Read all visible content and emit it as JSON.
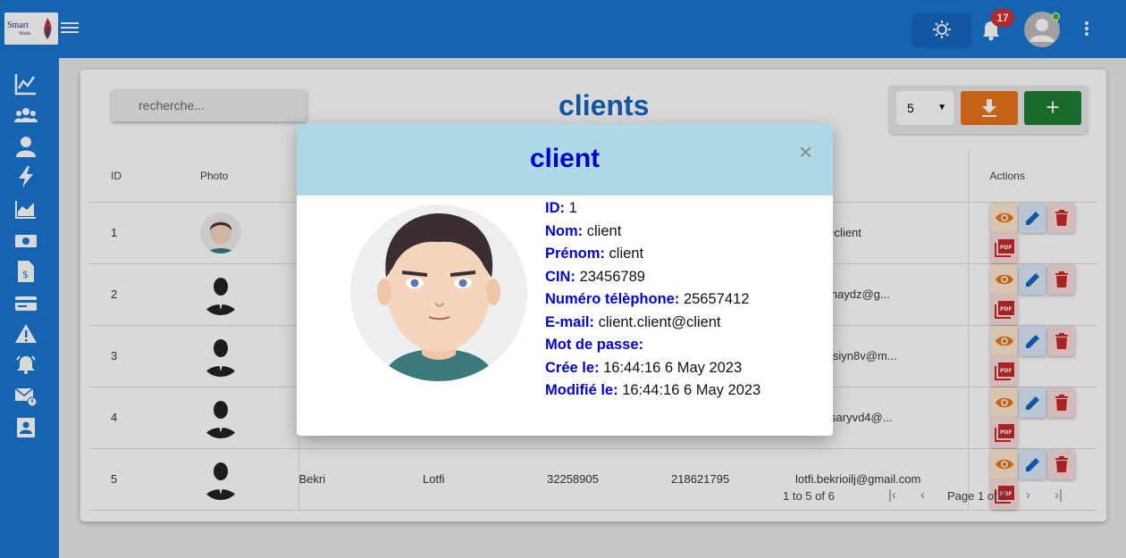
{
  "app": {
    "logo_line1": "Smart",
    "logo_line2": "Watts"
  },
  "header": {
    "notification_count": "17"
  },
  "page": {
    "title": "clients",
    "search_placeholder": "recherche...",
    "page_size": "5",
    "add_label": "+"
  },
  "table": {
    "headers": {
      "id": "ID",
      "photo": "Photo",
      "actions": "Actions"
    },
    "rows": [
      {
        "id": "1",
        "nom": "",
        "prenom": "",
        "cin": "",
        "tel": "",
        "email": "client@client"
      },
      {
        "id": "2",
        "nom": "",
        "prenom": "",
        "cin": "",
        "tel": "",
        "email": "ahfoudhaydz@g..."
      },
      {
        "id": "3",
        "nom": "",
        "prenom": "",
        "cin": "",
        "tel": "",
        "email": "bensassiyn8v@m..."
      },
      {
        "id": "4",
        "nom": "",
        "prenom": "",
        "cin": "",
        "tel": "",
        "email": "oussarsaryvd4@..."
      },
      {
        "id": "5",
        "nom": "Bekri",
        "prenom": "Lotfi",
        "cin": "32258905",
        "tel": "218621795",
        "email": "lotfi.bekrioilj@gmail.com"
      }
    ]
  },
  "pagination": {
    "range": "1 to 5 of 6",
    "page": "Page 1 of 2"
  },
  "modal": {
    "title": "client",
    "close": "×",
    "fields": [
      {
        "label": "ID:",
        "value": "1"
      },
      {
        "label": "Nom:",
        "value": "client"
      },
      {
        "label": "Prénom:",
        "value": "client"
      },
      {
        "label": "CIN:",
        "value": "23456789"
      },
      {
        "label": "Numéro télèphone:",
        "value": "25657412"
      },
      {
        "label": "E-mail:",
        "value": "client.client@client"
      },
      {
        "label": "Mot de passe:",
        "value": ""
      },
      {
        "label": "Crée le:",
        "value": "16:44:16 6 May 2023"
      },
      {
        "label": "Modifié le:",
        "value": "16:44:16 6 May 2023"
      }
    ]
  },
  "colors": {
    "primary": "#1976d2",
    "title_blue": "#0000cc",
    "modal_header": "#add8e6",
    "download": "#e8741a",
    "add": "#1e7e34"
  },
  "icons": [
    "menu-icon",
    "sun-icon",
    "bell-icon",
    "account-icon",
    "more-vert-icon",
    "chart-line-icon",
    "people-icon",
    "person-icon",
    "bolt-icon",
    "area-chart-icon",
    "money-icon",
    "invoice-icon",
    "card-icon",
    "warning-icon",
    "alarm-icon",
    "mail-alert-icon",
    "contact-icon",
    "download-icon",
    "eye-icon",
    "pencil-icon",
    "trash-icon",
    "pdf-icon"
  ]
}
